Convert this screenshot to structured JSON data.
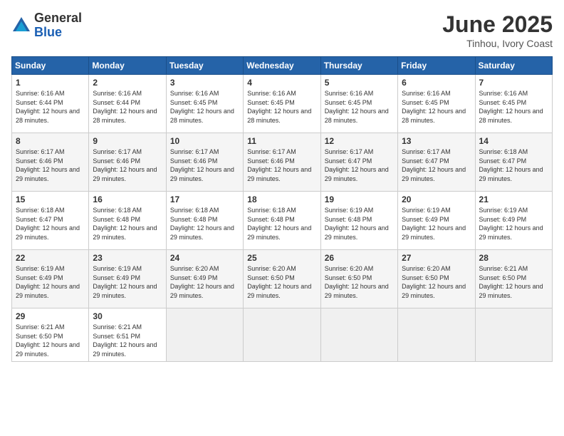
{
  "logo": {
    "general": "General",
    "blue": "Blue"
  },
  "title": {
    "month": "June 2025",
    "location": "Tinhou, Ivory Coast"
  },
  "weekdays": [
    "Sunday",
    "Monday",
    "Tuesday",
    "Wednesday",
    "Thursday",
    "Friday",
    "Saturday"
  ],
  "weeks": [
    [
      {
        "day": "1",
        "sunrise": "6:16 AM",
        "sunset": "6:44 PM",
        "daylight": "12 hours and 28 minutes."
      },
      {
        "day": "2",
        "sunrise": "6:16 AM",
        "sunset": "6:44 PM",
        "daylight": "12 hours and 28 minutes."
      },
      {
        "day": "3",
        "sunrise": "6:16 AM",
        "sunset": "6:45 PM",
        "daylight": "12 hours and 28 minutes."
      },
      {
        "day": "4",
        "sunrise": "6:16 AM",
        "sunset": "6:45 PM",
        "daylight": "12 hours and 28 minutes."
      },
      {
        "day": "5",
        "sunrise": "6:16 AM",
        "sunset": "6:45 PM",
        "daylight": "12 hours and 28 minutes."
      },
      {
        "day": "6",
        "sunrise": "6:16 AM",
        "sunset": "6:45 PM",
        "daylight": "12 hours and 28 minutes."
      },
      {
        "day": "7",
        "sunrise": "6:16 AM",
        "sunset": "6:45 PM",
        "daylight": "12 hours and 28 minutes."
      }
    ],
    [
      {
        "day": "8",
        "sunrise": "6:17 AM",
        "sunset": "6:46 PM",
        "daylight": "12 hours and 29 minutes."
      },
      {
        "day": "9",
        "sunrise": "6:17 AM",
        "sunset": "6:46 PM",
        "daylight": "12 hours and 29 minutes."
      },
      {
        "day": "10",
        "sunrise": "6:17 AM",
        "sunset": "6:46 PM",
        "daylight": "12 hours and 29 minutes."
      },
      {
        "day": "11",
        "sunrise": "6:17 AM",
        "sunset": "6:46 PM",
        "daylight": "12 hours and 29 minutes."
      },
      {
        "day": "12",
        "sunrise": "6:17 AM",
        "sunset": "6:47 PM",
        "daylight": "12 hours and 29 minutes."
      },
      {
        "day": "13",
        "sunrise": "6:17 AM",
        "sunset": "6:47 PM",
        "daylight": "12 hours and 29 minutes."
      },
      {
        "day": "14",
        "sunrise": "6:18 AM",
        "sunset": "6:47 PM",
        "daylight": "12 hours and 29 minutes."
      }
    ],
    [
      {
        "day": "15",
        "sunrise": "6:18 AM",
        "sunset": "6:47 PM",
        "daylight": "12 hours and 29 minutes."
      },
      {
        "day": "16",
        "sunrise": "6:18 AM",
        "sunset": "6:48 PM",
        "daylight": "12 hours and 29 minutes."
      },
      {
        "day": "17",
        "sunrise": "6:18 AM",
        "sunset": "6:48 PM",
        "daylight": "12 hours and 29 minutes."
      },
      {
        "day": "18",
        "sunrise": "6:18 AM",
        "sunset": "6:48 PM",
        "daylight": "12 hours and 29 minutes."
      },
      {
        "day": "19",
        "sunrise": "6:19 AM",
        "sunset": "6:48 PM",
        "daylight": "12 hours and 29 minutes."
      },
      {
        "day": "20",
        "sunrise": "6:19 AM",
        "sunset": "6:49 PM",
        "daylight": "12 hours and 29 minutes."
      },
      {
        "day": "21",
        "sunrise": "6:19 AM",
        "sunset": "6:49 PM",
        "daylight": "12 hours and 29 minutes."
      }
    ],
    [
      {
        "day": "22",
        "sunrise": "6:19 AM",
        "sunset": "6:49 PM",
        "daylight": "12 hours and 29 minutes."
      },
      {
        "day": "23",
        "sunrise": "6:19 AM",
        "sunset": "6:49 PM",
        "daylight": "12 hours and 29 minutes."
      },
      {
        "day": "24",
        "sunrise": "6:20 AM",
        "sunset": "6:49 PM",
        "daylight": "12 hours and 29 minutes."
      },
      {
        "day": "25",
        "sunrise": "6:20 AM",
        "sunset": "6:50 PM",
        "daylight": "12 hours and 29 minutes."
      },
      {
        "day": "26",
        "sunrise": "6:20 AM",
        "sunset": "6:50 PM",
        "daylight": "12 hours and 29 minutes."
      },
      {
        "day": "27",
        "sunrise": "6:20 AM",
        "sunset": "6:50 PM",
        "daylight": "12 hours and 29 minutes."
      },
      {
        "day": "28",
        "sunrise": "6:21 AM",
        "sunset": "6:50 PM",
        "daylight": "12 hours and 29 minutes."
      }
    ],
    [
      {
        "day": "29",
        "sunrise": "6:21 AM",
        "sunset": "6:50 PM",
        "daylight": "12 hours and 29 minutes."
      },
      {
        "day": "30",
        "sunrise": "6:21 AM",
        "sunset": "6:51 PM",
        "daylight": "12 hours and 29 minutes."
      },
      null,
      null,
      null,
      null,
      null
    ]
  ]
}
